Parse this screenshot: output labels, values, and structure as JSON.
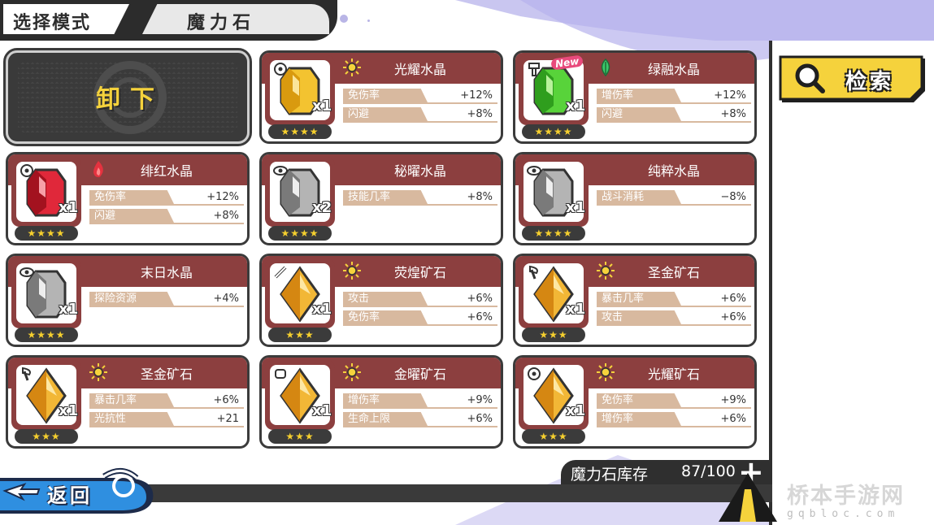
{
  "header": {
    "mode_label": "选择模式",
    "title": "魔力石"
  },
  "unequip": {
    "label": "卸下"
  },
  "search": {
    "label": "检索"
  },
  "back": {
    "label": "返回"
  },
  "inventory": {
    "label": "魔力石库存",
    "count": "87/100",
    "add": "+"
  },
  "watermark": {
    "text": "桥本手游网",
    "url": "gqbloc.com"
  },
  "cards": [
    {
      "name": "光耀水晶",
      "element_icon": "sun-icon",
      "type_icon": "target-icon",
      "gem": "yellow-crystal",
      "qty": "x1",
      "stars": "★★★★",
      "new": "",
      "stats": [
        {
          "label": "免伤率",
          "value": "+12%"
        },
        {
          "label": "闪避",
          "value": "+8%"
        }
      ]
    },
    {
      "name": "绿融水晶",
      "element_icon": "leaf-icon",
      "type_icon": "hammer-icon",
      "gem": "green-crystal",
      "qty": "x1",
      "stars": "★★★★",
      "new": "New",
      "stats": [
        {
          "label": "增伤率",
          "value": "+12%"
        },
        {
          "label": "闪避",
          "value": "+8%"
        }
      ]
    },
    {
      "name": "绯红水晶",
      "element_icon": "flame-icon",
      "type_icon": "target-icon",
      "gem": "red-crystal",
      "qty": "x1",
      "stars": "★★★★",
      "new": "",
      "stats": [
        {
          "label": "免伤率",
          "value": "+12%"
        },
        {
          "label": "闪避",
          "value": "+8%"
        }
      ]
    },
    {
      "name": "秘曜水晶",
      "element_icon": "",
      "type_icon": "eye-icon",
      "gem": "gray-crystal",
      "qty": "x2",
      "stars": "★★★★",
      "new": "",
      "stats": [
        {
          "label": "技能几率",
          "value": "+8%"
        }
      ]
    },
    {
      "name": "纯粹水晶",
      "element_icon": "",
      "type_icon": "eye-icon",
      "gem": "gray-crystal",
      "qty": "x1",
      "stars": "★★★★",
      "new": "",
      "stats": [
        {
          "label": "战斗消耗",
          "value": "−8%"
        }
      ]
    },
    {
      "name": "末日水晶",
      "element_icon": "",
      "type_icon": "eye-icon",
      "gem": "gray-crystal",
      "qty": "x1",
      "stars": "★★★★",
      "new": "",
      "stats": [
        {
          "label": "探险资源",
          "value": "+4%"
        }
      ]
    },
    {
      "name": "荧煌矿石",
      "element_icon": "sun-icon",
      "type_icon": "sword-icon",
      "gem": "gold-ore",
      "qty": "x1",
      "stars": "★★★",
      "new": "",
      "stats": [
        {
          "label": "攻击",
          "value": "+6%"
        },
        {
          "label": "免伤率",
          "value": "+6%"
        }
      ]
    },
    {
      "name": "圣金矿石",
      "element_icon": "sun-icon",
      "type_icon": "axe-icon",
      "gem": "gold-ore",
      "qty": "x1",
      "stars": "★★★",
      "new": "",
      "stats": [
        {
          "label": "暴击几率",
          "value": "+6%"
        },
        {
          "label": "攻击",
          "value": "+6%"
        }
      ]
    },
    {
      "name": "圣金矿石",
      "element_icon": "sun-icon",
      "type_icon": "axe-icon",
      "gem": "gold-ore",
      "qty": "x1",
      "stars": "★★★",
      "new": "",
      "stats": [
        {
          "label": "暴击几率",
          "value": "+6%"
        },
        {
          "label": "光抗性",
          "value": "+21"
        }
      ]
    },
    {
      "name": "金曜矿石",
      "element_icon": "sun-icon",
      "type_icon": "fist-icon",
      "gem": "gold-ore",
      "qty": "x1",
      "stars": "★★★",
      "new": "",
      "stats": [
        {
          "label": "增伤率",
          "value": "+9%"
        },
        {
          "label": "生命上限",
          "value": "+6%"
        }
      ]
    },
    {
      "name": "光耀矿石",
      "element_icon": "sun-icon",
      "type_icon": "target-icon",
      "gem": "gold-ore",
      "qty": "x1",
      "stars": "★★★",
      "new": "",
      "stats": [
        {
          "label": "免伤率",
          "value": "+9%"
        },
        {
          "label": "增伤率",
          "value": "+6%"
        }
      ]
    }
  ],
  "colors": {
    "card_band": "#8c3f3f",
    "stat_pill": "#d8b99f",
    "accent_yellow": "#f5d23c",
    "dark": "#2f2f2f",
    "lilac": "#c9c6f0"
  }
}
